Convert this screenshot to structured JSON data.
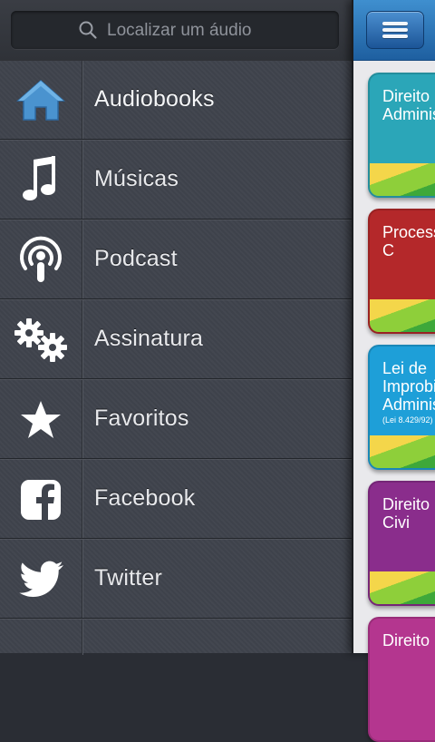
{
  "search": {
    "placeholder": "Localizar um áudio",
    "icon": "search-icon"
  },
  "menu": {
    "items": [
      {
        "label": "Audiobooks",
        "icon": "home-icon",
        "active": true
      },
      {
        "label": "Músicas",
        "icon": "music-note-icon"
      },
      {
        "label": "Podcast",
        "icon": "podcast-icon"
      },
      {
        "label": "Assinatura",
        "icon": "gears-icon"
      },
      {
        "label": "Favoritos",
        "icon": "star-icon"
      },
      {
        "label": "Facebook",
        "icon": "facebook-icon"
      },
      {
        "label": "Twitter",
        "icon": "twitter-bird-icon"
      }
    ]
  },
  "content": {
    "menu_button_icon": "hamburger-icon",
    "books": [
      {
        "title": "Direito\nAdminis",
        "color": "#2ba6b8"
      },
      {
        "title": "Processo\n           C",
        "color": "#b4282a"
      },
      {
        "title": "Lei de\nImprobic\nAdminis",
        "subtitle": "(Lei 8.429/92)",
        "color": "#1e9fd8"
      },
      {
        "title": "Direito\n      Civi",
        "color": "#8a2d8c"
      },
      {
        "title": "Direito",
        "color": "#b4368f"
      }
    ]
  },
  "colors": {
    "drawer_bg": "#3f434c",
    "topbar_blue": "#2b74b8",
    "home_icon_blue": "#4a93cf"
  }
}
